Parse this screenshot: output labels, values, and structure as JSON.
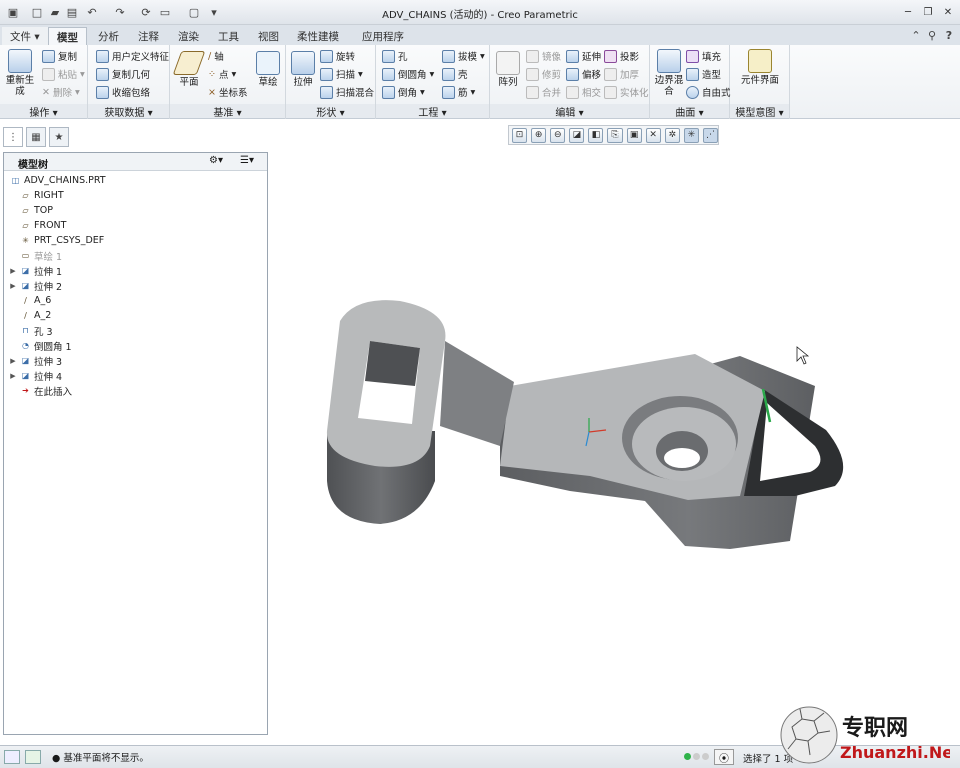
{
  "window": {
    "title": "ADV_CHAINS (活动的) - Creo Parametric"
  },
  "tabs": [
    "文件",
    "模型",
    "分析",
    "注释",
    "渲染",
    "工具",
    "视图",
    "柔性建模",
    "应用程序"
  ],
  "ribbon": {
    "groups": {
      "operation": "操作",
      "get_data": "获取数据",
      "datum": "基准",
      "shape": "形状",
      "engineering": "工程",
      "edit": "编辑",
      "surface": "曲面",
      "model_intent": "模型意图"
    },
    "items": {
      "regenerate": "重新生成",
      "copy": "复制",
      "paste": "粘贴",
      "delete": "删除",
      "udf": "用户定义特征",
      "copy_geom": "复制几何",
      "shrinkwrap": "收缩包络",
      "plane": "平面",
      "axis": "轴",
      "point": "点",
      "csys": "坐标系",
      "sketch": "草绘",
      "extrude": "拉伸",
      "revolve": "旋转",
      "sweep": "扫描",
      "swept_blend": "扫描混合",
      "hole": "孔",
      "round": "倒圆角",
      "chamfer": "倒角",
      "draft": "拔模",
      "shell": "壳",
      "rib": "筋",
      "pattern": "阵列",
      "mirror": "镜像",
      "extend": "延伸",
      "project": "投影",
      "trim": "修剪",
      "offset": "偏移",
      "thicken": "加厚",
      "merge": "合并",
      "intersect": "相交",
      "solidify": "实体化",
      "boundary_blend": "边界混合",
      "fill": "填充",
      "style": "造型",
      "freestyle": "自由式",
      "component_interface": "元件界面"
    }
  },
  "model_tree": {
    "header": "模型树",
    "nodes": [
      {
        "label": "ADV_CHAINS.PRT",
        "icon": "part-icon",
        "expandable": false,
        "disabled": false
      },
      {
        "label": "RIGHT",
        "icon": "datum-plane-icon",
        "expandable": false,
        "disabled": false
      },
      {
        "label": "TOP",
        "icon": "datum-plane-icon",
        "expandable": false,
        "disabled": false
      },
      {
        "label": "FRONT",
        "icon": "datum-plane-icon",
        "expandable": false,
        "disabled": false
      },
      {
        "label": "PRT_CSYS_DEF",
        "icon": "csys-icon",
        "expandable": false,
        "disabled": false
      },
      {
        "label": "草绘 1",
        "icon": "sketch-icon",
        "expandable": false,
        "disabled": true
      },
      {
        "label": "拉伸 1",
        "icon": "extrude-icon",
        "expandable": true,
        "disabled": false
      },
      {
        "label": "拉伸 2",
        "icon": "extrude-icon",
        "expandable": true,
        "disabled": false
      },
      {
        "label": "A_6",
        "icon": "axis-icon",
        "expandable": false,
        "disabled": false
      },
      {
        "label": "A_2",
        "icon": "axis-icon",
        "expandable": false,
        "disabled": false
      },
      {
        "label": "孔 3",
        "icon": "hole-icon",
        "expandable": false,
        "disabled": false
      },
      {
        "label": "倒圆角 1",
        "icon": "round-icon",
        "expandable": false,
        "disabled": false
      },
      {
        "label": "拉伸 3",
        "icon": "extrude-icon",
        "expandable": true,
        "disabled": false
      },
      {
        "label": "拉伸 4",
        "icon": "extrude-icon",
        "expandable": true,
        "disabled": false
      },
      {
        "label": "在此插入",
        "icon": "insert-here-icon",
        "expandable": false,
        "disabled": false
      }
    ]
  },
  "status": {
    "message": "基准平面将不显示。",
    "selection": "选择了 1 项"
  },
  "watermark": {
    "cn": "专职网",
    "en": "Zhuanzhi.Net"
  },
  "colors": {
    "accent": "#3c6ea8",
    "model_top": "#b4b6b8",
    "model_side": "#5b5d60",
    "insert_arrow": "#c0181a"
  }
}
